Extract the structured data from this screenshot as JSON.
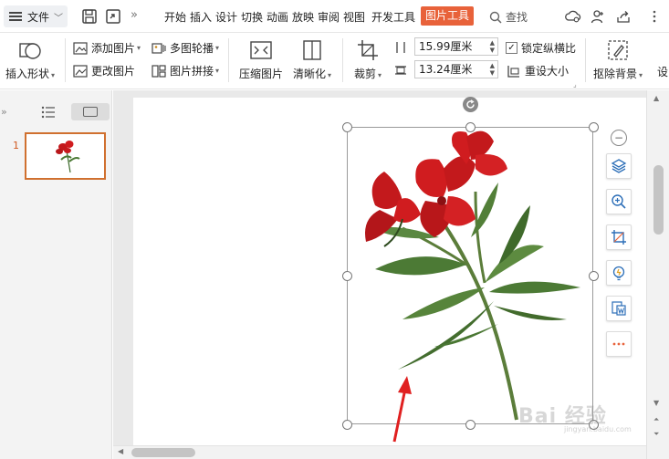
{
  "menubar": {
    "file_label": "文件",
    "items": [
      "开始",
      "插入",
      "设计",
      "切换",
      "动画",
      "放映",
      "审阅",
      "视图",
      "开发工具"
    ],
    "active_tab": "图片工具",
    "search_label": "查找"
  },
  "ribbon": {
    "insert_shape": "插入形状",
    "add_picture": "添加图片",
    "change_picture": "更改图片",
    "multi_carousel": "多图轮播",
    "picture_collage": "图片拼接",
    "compress_picture": "压缩图片",
    "sharpen": "清晰化",
    "crop": "裁剪",
    "width_value": "15.99厘米",
    "height_value": "13.24厘米",
    "lock_ratio": "锁定纵横比",
    "reset_size": "重设大小",
    "remove_background": "抠除背景",
    "settings_partial": "设"
  },
  "thumbnails": [
    {
      "number": "1"
    }
  ],
  "watermark": {
    "text": "Bai 经验",
    "sub": "jingyan.baidu.com"
  },
  "colors": {
    "accent": "#e8623a",
    "thumb_border": "#d0702f",
    "flower_red": "#d01c1f",
    "leaf_green": "#4c7a35",
    "arrow_red": "#e02020"
  }
}
